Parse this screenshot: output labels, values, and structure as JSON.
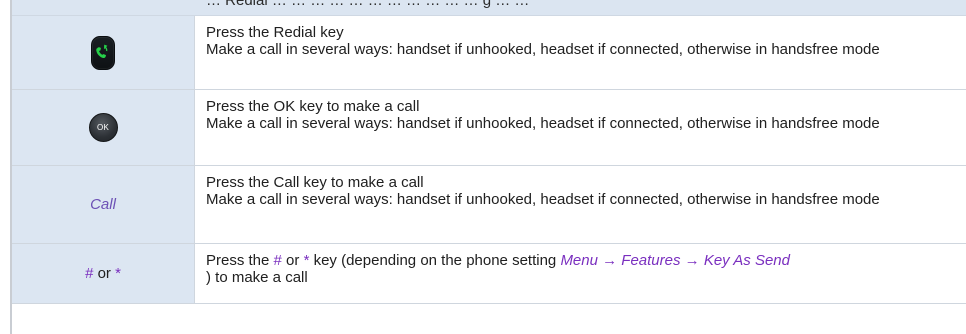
{
  "header": {
    "partial_text": "… Redial … … … … … … … … … … … g … …"
  },
  "rows": [
    {
      "left_type": "redial-icon",
      "title": "Press the Redial key",
      "body": "Make a call in several ways: handset if unhooked, headset if connected, otherwise in handsfree mode"
    },
    {
      "left_type": "ok-icon",
      "left_text": "OK",
      "title": "Press the OK key to make a call",
      "body": "Make a call in several ways: handset if unhooked, headset if connected, otherwise in handsfree mode"
    },
    {
      "left_type": "text",
      "left_text": "Call",
      "title": "Press the Call key to make a call",
      "body": "Make a call in several ways: handset if unhooked, headset if connected, otherwise in handsfree mode"
    },
    {
      "left_type": "keys",
      "left_key_hash": "#",
      "left_or": "or",
      "left_key_star": "*",
      "desc_parts": {
        "prefix": "Press the ",
        "key_hash": "#",
        "or": "or ",
        "key_star": "*",
        "middle": " key (depending on the phone setting ",
        "menu_path": "Menu → Features →  Key As Send",
        "suffix": ") to make a call"
      }
    }
  ],
  "colors": {
    "left_cell_bg": "#dce6f2",
    "accent_purple": "#7a2fbf",
    "redial_green": "#26d14a",
    "border": "#cfd6de"
  }
}
